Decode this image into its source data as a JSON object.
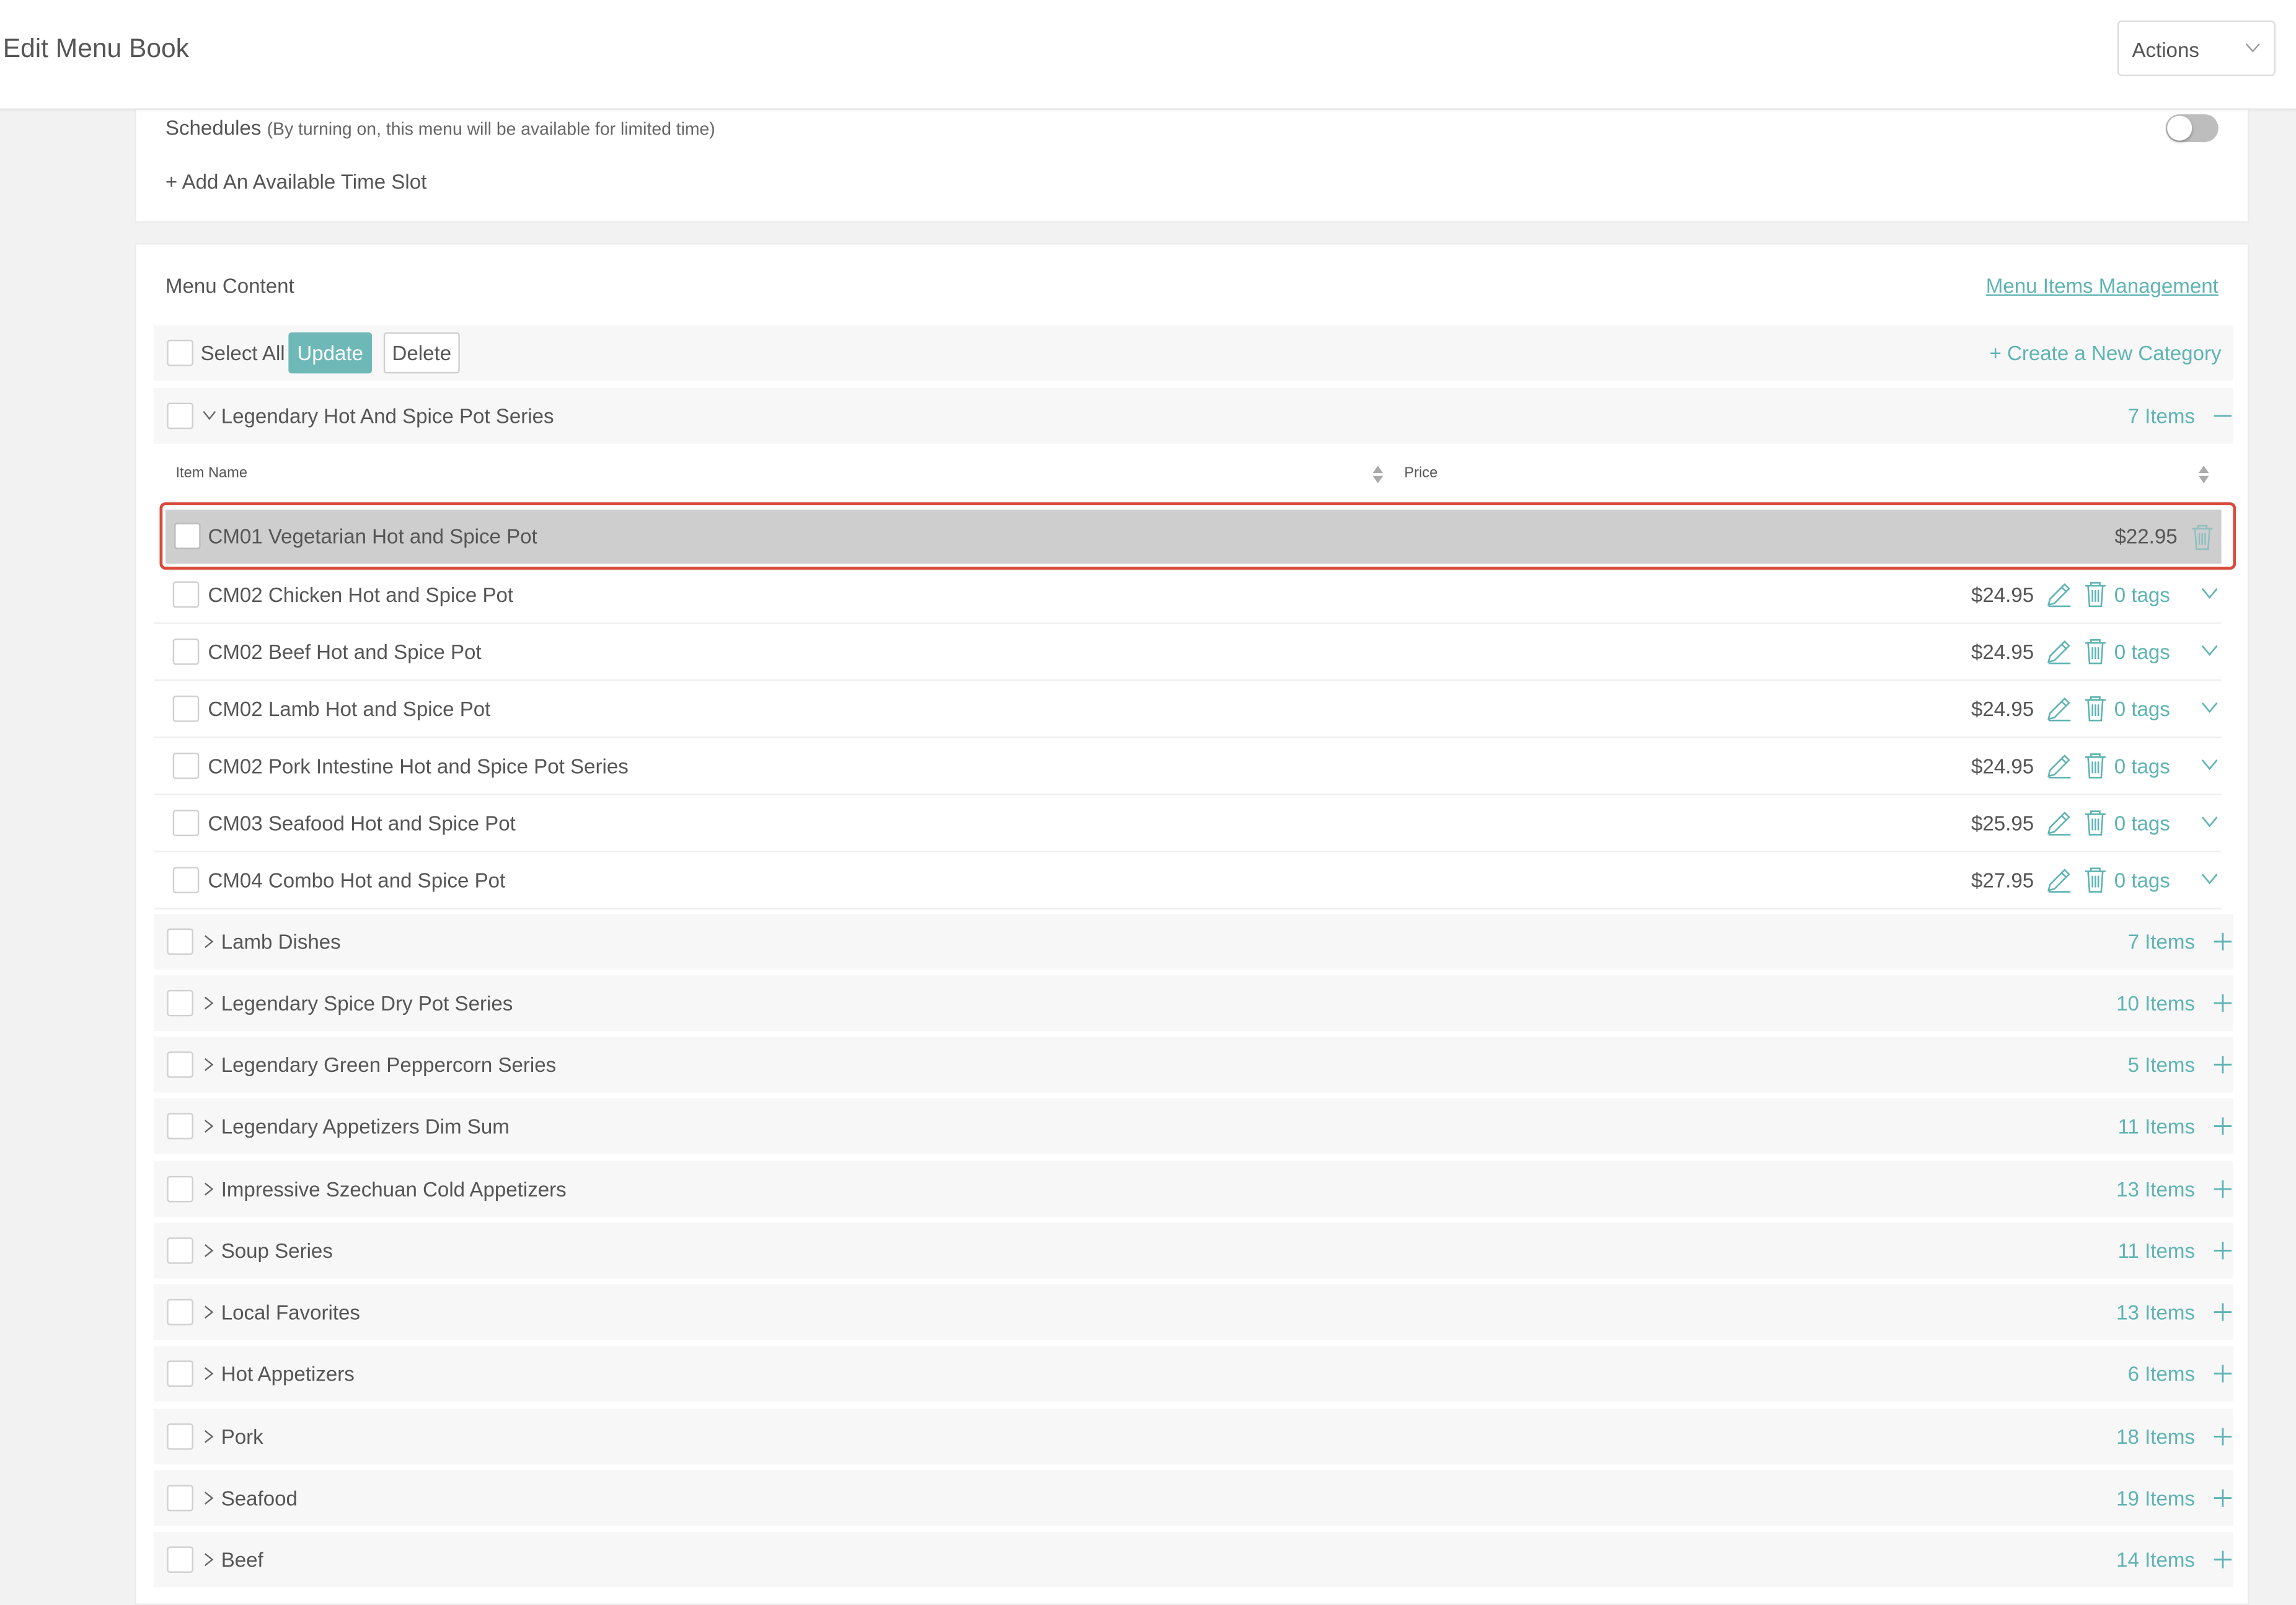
{
  "header": {
    "title": "Edit Menu Book",
    "actions_label": "Actions"
  },
  "schedule": {
    "title": "Schedules",
    "note": "(By turning on, this menu will be available for limited time)",
    "add_slot_label": "+ Add An Available Time Slot",
    "toggle_on": false
  },
  "menu_content": {
    "title": "Menu Content",
    "management_link": "Menu Items Management",
    "toolbar": {
      "select_all_label": "Select All",
      "update_label": "Update",
      "delete_label": "Delete",
      "create_category_label": "+ Create a New Category"
    },
    "open_category": {
      "name": "Legendary Hot And Spice Pot Series",
      "count": "7 Items",
      "columns": {
        "item_name": "Item Name",
        "price": "Price"
      },
      "dragging_item": {
        "name": "CM01 Vegetarian Hot and Spice Pot",
        "price": "$22.95"
      },
      "items": [
        {
          "name": "CM02 Chicken Hot and Spice Pot",
          "price": "$24.95",
          "tags": "0 tags"
        },
        {
          "name": "CM02 Beef Hot and Spice Pot",
          "price": "$24.95",
          "tags": "0 tags"
        },
        {
          "name": "CM02 Lamb Hot and Spice Pot",
          "price": "$24.95",
          "tags": "0 tags"
        },
        {
          "name": "CM02 Pork Intestine Hot and Spice Pot Series",
          "price": "$24.95",
          "tags": "0 tags"
        },
        {
          "name": "CM03 Seafood Hot and Spice Pot",
          "price": "$25.95",
          "tags": "0 tags"
        },
        {
          "name": "CM04 Combo Hot and Spice Pot",
          "price": "$27.95",
          "tags": "0 tags"
        }
      ]
    },
    "categories": [
      {
        "name": "Lamb Dishes",
        "count": "7 Items"
      },
      {
        "name": "Legendary Spice Dry Pot Series",
        "count": "10 Items"
      },
      {
        "name": "Legendary Green Peppercorn Series",
        "count": "5 Items"
      },
      {
        "name": "Legendary Appetizers Dim Sum",
        "count": "11 Items"
      },
      {
        "name": "Impressive Szechuan Cold Appetizers",
        "count": "13 Items"
      },
      {
        "name": "Soup Series",
        "count": "11 Items"
      },
      {
        "name": "Local Favorites",
        "count": "13 Items"
      },
      {
        "name": "Hot Appetizers",
        "count": "6 Items"
      },
      {
        "name": "Pork",
        "count": "18 Items"
      },
      {
        "name": "Seafood",
        "count": "19 Items"
      },
      {
        "name": "Beef",
        "count": "14 Items"
      }
    ]
  },
  "colors": {
    "accent": "#5fb3b3",
    "update_button": "#6fb8b8",
    "highlight_border": "#d84a3a",
    "drag_row": "#cecece"
  }
}
